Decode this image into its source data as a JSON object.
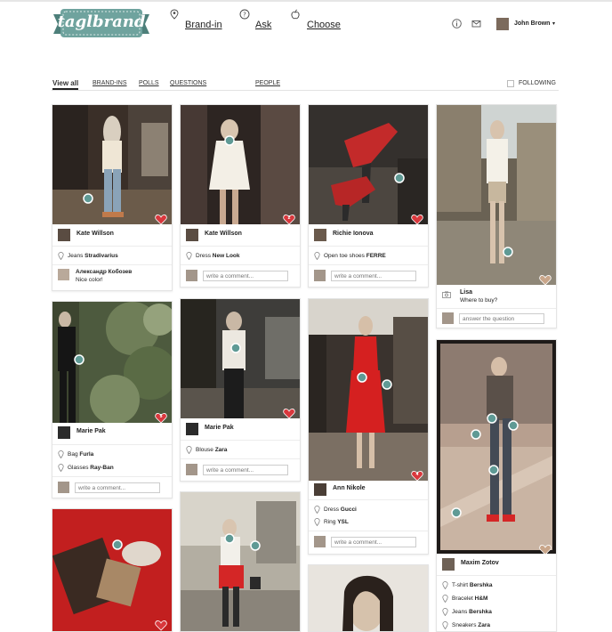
{
  "header": {
    "logo_text": "taglbrand",
    "nav": [
      {
        "label": "Brand-in",
        "icon": "map-pin-icon"
      },
      {
        "label": "Ask",
        "icon": "question-icon"
      },
      {
        "label": "Choose",
        "icon": "apple-icon"
      }
    ],
    "info_icon": "info-icon",
    "mail_icon": "mail-icon",
    "user_name": "John Brown",
    "user_caret": "▾"
  },
  "tabs": [
    {
      "label": "View all",
      "active": true
    },
    {
      "label": "BRAND-INS"
    },
    {
      "label": "POLLS"
    },
    {
      "label": "QUESTIONS"
    },
    {
      "label": "PEOPLE"
    }
  ],
  "following_label": "FOLLOWING",
  "colors": {
    "accent_teal": "#5f9a95",
    "heart_red": "#d9383d",
    "heart_tan": "#c9a68a",
    "red_dress": "#d82222"
  },
  "cards": [
    {
      "author": "Kate Willson",
      "tags": [
        {
          "name": "Jeans",
          "brand": "Stradivarius"
        }
      ],
      "comment": {
        "author": "Александр Кобозев",
        "text": "Nice color!"
      },
      "likes": ""
    },
    {
      "author": "Kate Willson",
      "tags": [
        {
          "name": "Dress",
          "brand": "New Look"
        }
      ],
      "comment_placeholder": "write a comment...",
      "likes": "2"
    },
    {
      "author": "Richie Ionova",
      "tags": [
        {
          "name": "Open toe shoes",
          "brand": "FERRE"
        }
      ],
      "comment_placeholder": "write a comment...",
      "likes": ""
    },
    {
      "author": "Lisa",
      "question": "Where to buy?",
      "answer_placeholder": "answer the question"
    },
    {
      "author": "Marie Pak",
      "tags": [
        {
          "name": "Bag",
          "brand": "Furla"
        },
        {
          "name": "Glasses",
          "brand": "Ray-Ban"
        }
      ],
      "comment_placeholder": "write a comment...",
      "likes": "5"
    },
    {
      "author": "Marie Pak",
      "tags": [
        {
          "name": "Blouse",
          "brand": "Zara"
        }
      ],
      "comment_placeholder": "write a comment...",
      "likes": ""
    },
    {
      "author": "Ann Nikole",
      "tags": [
        {
          "name": "Dress",
          "brand": "Gucci"
        },
        {
          "name": "Ring",
          "brand": "YSL"
        }
      ],
      "comment_placeholder": "write a comment...",
      "likes": "4"
    },
    {
      "author": "Maxim Zotov",
      "tags": [
        {
          "name": "T-shirt",
          "brand": "Bershka"
        },
        {
          "name": "Bracelet",
          "brand": "H&M"
        },
        {
          "name": "Jeans",
          "brand": "Bershka"
        },
        {
          "name": "Sneakers",
          "brand": "Zara"
        }
      ]
    }
  ]
}
